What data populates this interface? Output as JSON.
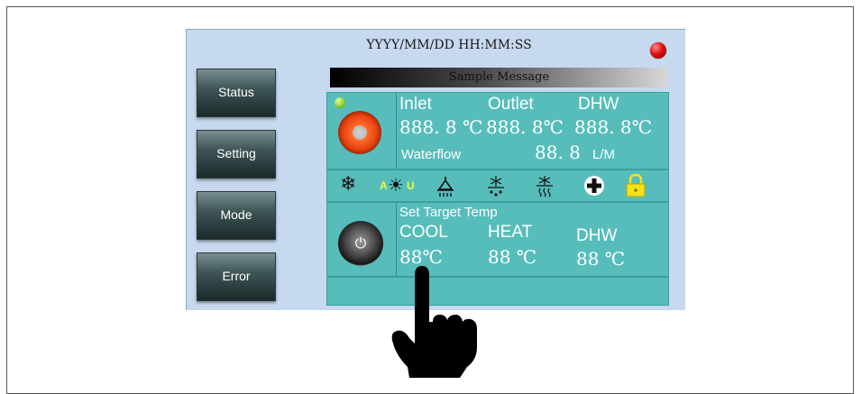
{
  "header": {
    "datetime": "YYYY/MM/DD HH:MM:SS",
    "message": "Sample Message"
  },
  "sidebar": {
    "items": [
      {
        "label": "Status"
      },
      {
        "label": "Setting"
      },
      {
        "label": "Mode"
      },
      {
        "label": "Error"
      }
    ]
  },
  "temps": {
    "inlet_label": "Inlet",
    "outlet_label": "Outlet",
    "dhw_label": "DHW",
    "inlet_value": "888. 8 ℃",
    "outlet_value": "888. 8℃",
    "dhw_value": "888. 8℃",
    "waterflow_label": "Waterflow",
    "waterflow_value": "88. 8",
    "waterflow_unit": "L/M"
  },
  "mode_icons": {
    "auto_a": "A",
    "auto_u": "U",
    "items": [
      "snowflake-icon",
      "sun-icon",
      "shower-icon",
      "defrost-drip-icon",
      "defrost-heat-icon",
      "plus-icon",
      "lock-icon"
    ]
  },
  "target": {
    "title": "Set Target Temp",
    "cool_label": "COOL",
    "heat_label": "HEAT",
    "dhw_label": "DHW",
    "cool_value": "88℃",
    "heat_value": "88 ℃",
    "dhw_value": "88 ℃"
  },
  "colors": {
    "panel": "#56bdbb",
    "screen_bg": "#c7d9ee",
    "alarm_led": "#e01010",
    "status_led": "#8acb2a",
    "lock": "#f4e21a"
  }
}
